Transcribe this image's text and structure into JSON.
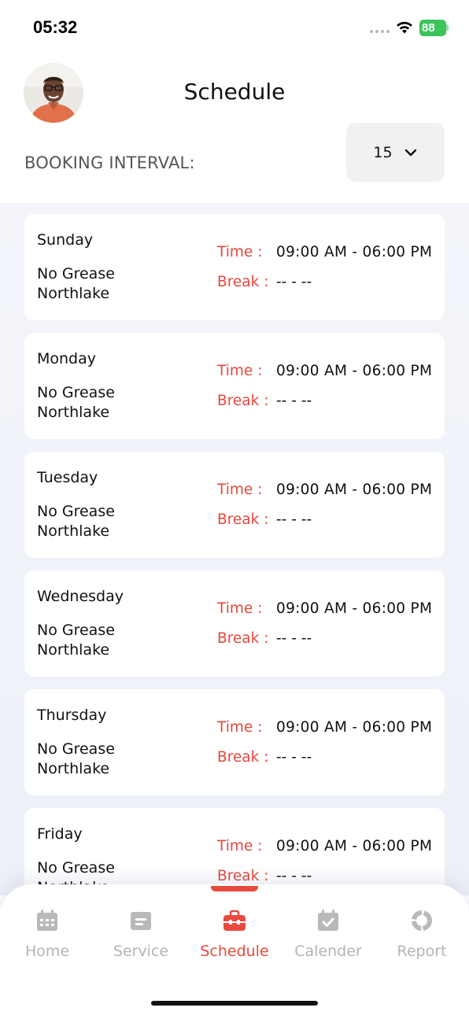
{
  "status_bar": {
    "time": "05:32",
    "battery": "88"
  },
  "header": {
    "title": "Schedule"
  },
  "booking": {
    "label": "BOOKING INTERVAL:",
    "interval_value": "15"
  },
  "schedule": {
    "time_label": "Time :",
    "break_label": "Break :",
    "days": [
      {
        "day": "Sunday",
        "store": "No Grease Northlake",
        "time": "09:00 AM - 06:00 PM",
        "break": "-- - --"
      },
      {
        "day": "Monday",
        "store": "No Grease Northlake",
        "time": "09:00 AM - 06:00 PM",
        "break": "-- - --"
      },
      {
        "day": "Tuesday",
        "store": "No Grease Northlake",
        "time": "09:00 AM - 06:00 PM",
        "break": "-- - --"
      },
      {
        "day": "Wednesday",
        "store": "No Grease Northlake",
        "time": "09:00 AM - 06:00 PM",
        "break": "-- - --"
      },
      {
        "day": "Thursday",
        "store": "No Grease Northlake",
        "time": "09:00 AM - 06:00 PM",
        "break": "-- - --"
      },
      {
        "day": "Friday",
        "store": "No Grease Northlake",
        "time": "09:00 AM - 06:00 PM",
        "break": "-- - --"
      }
    ]
  },
  "nav": {
    "items": [
      {
        "label": "Home",
        "icon": "calendar-grid-icon",
        "active": false
      },
      {
        "label": "Service",
        "icon": "service-card-icon",
        "active": false
      },
      {
        "label": "Schedule",
        "icon": "toolbox-icon",
        "active": true
      },
      {
        "label": "Calender",
        "icon": "calendar-check-icon",
        "active": false
      },
      {
        "label": "Report",
        "icon": "report-ring-icon",
        "active": false
      }
    ]
  },
  "colors": {
    "accent": "#e84a3d",
    "inactive": "#b4b4b4",
    "battery": "#3cc45a"
  }
}
